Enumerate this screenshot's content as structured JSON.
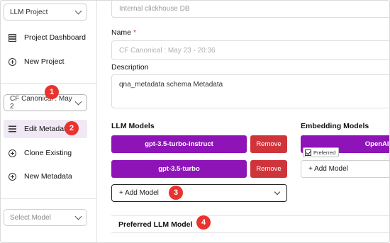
{
  "sidebar": {
    "project_select": "LLM Project",
    "items_top": [
      {
        "label": "Project Dashboard",
        "icon": "dashboard-icon"
      },
      {
        "label": "New Project",
        "icon": "plus-circle-icon"
      }
    ],
    "metadata_select": "CF Canonical : May 2",
    "items_bottom": [
      {
        "label": "Edit Metadata",
        "icon": "list-icon",
        "active": true
      },
      {
        "label": "Clone Existing",
        "icon": "plus-circle-icon"
      },
      {
        "label": "New Metadata",
        "icon": "plus-circle-icon"
      }
    ],
    "model_select_placeholder": "Select Model"
  },
  "badges": [
    "1",
    "2",
    "3",
    "4"
  ],
  "form": {
    "source_value": "Internal clickhouse DB",
    "name_label": "Name",
    "name_required": "*",
    "name_placeholder": "CF Canonical : May 23 - 20:36",
    "description_label": "Description",
    "description_value": "qna_metadata schema Metadata",
    "llm_models_label": "LLM Models",
    "llm_models": [
      {
        "name": "gpt-3.5-turbo-instruct",
        "remove_label": "Remove"
      },
      {
        "name": "gpt-3.5-turbo",
        "remove_label": "Remove"
      }
    ],
    "add_model_label": "+ Add Model",
    "embedding_models_label": "Embedding Models",
    "embedding_model_name": "OpenAI text e",
    "preferred_label": "Preferred",
    "embedding_add_model_label": "+ Add Model",
    "preferred_llm_model_label": "Preferred LLM Model"
  },
  "colors": {
    "accent": "#8e14b8",
    "remove": "#d0343b",
    "badge": "#e8332f",
    "active_bg": "#f1e8f6"
  }
}
